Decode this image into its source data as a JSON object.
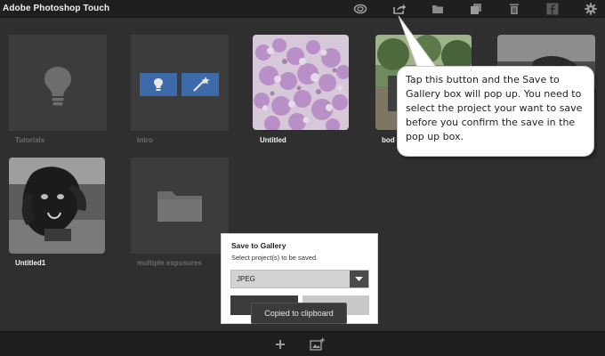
{
  "app": {
    "title": "Adobe Photoshop Touch"
  },
  "toolbar": {
    "icons": [
      "creative-cloud-icon",
      "share-icon",
      "folder-icon",
      "copy-icon",
      "trash-icon",
      "facebook-icon",
      "gear-icon"
    ]
  },
  "projects": [
    {
      "label": "Tutorials",
      "kind": "tutorials"
    },
    {
      "label": "Intro",
      "kind": "intro"
    },
    {
      "label": "Untitled",
      "kind": "photo-flowers"
    },
    {
      "label": "bod",
      "kind": "photo-garden"
    },
    {
      "label": "",
      "kind": "photo-dog-car"
    },
    {
      "label": "Untitled1",
      "kind": "photo-dog"
    },
    {
      "label": "multiple exposures",
      "kind": "folder"
    }
  ],
  "callout": {
    "text": "Tap this button and the Save to Gallery box will pop up. You need to select the project your want to save before you confirm the save in the pop up box."
  },
  "dialog": {
    "title": "Save to Gallery",
    "subtitle": "Select project(s) to be saved.",
    "format": "JPEG"
  },
  "toast": {
    "text": "Copied to clipboard"
  },
  "bottombar": {
    "icons": [
      "add-icon",
      "add-image-icon"
    ]
  }
}
